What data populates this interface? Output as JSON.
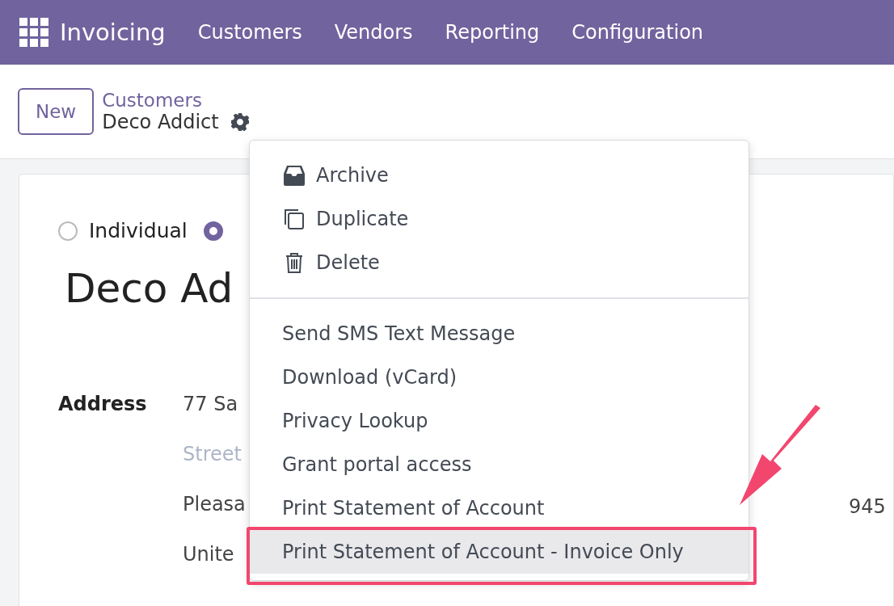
{
  "navbar": {
    "app_name": "Invoicing",
    "menu": [
      "Customers",
      "Vendors",
      "Reporting",
      "Configuration"
    ]
  },
  "control_panel": {
    "new_button": "New",
    "breadcrumb": "Customers",
    "record": "Deco Addict"
  },
  "form": {
    "company_types": [
      {
        "label": "Individual",
        "selected": false
      },
      {
        "selected": true
      }
    ],
    "name": "Deco Ad",
    "address_label": "Address",
    "street": "77 Sa",
    "street2_placeholder": "Street",
    "city": "Pleasa",
    "country": "Unite",
    "zip": "945"
  },
  "action_menu": {
    "groups": [
      [
        {
          "label": "Archive",
          "kind": "archive",
          "selected": false
        },
        {
          "label": "Duplicate",
          "kind": "duplicate",
          "selected": false
        },
        {
          "label": "Delete",
          "kind": "delete",
          "selected": false
        }
      ],
      [
        {
          "label": "Send SMS Text Message",
          "kind": "text",
          "selected": false
        },
        {
          "label": "Download (vCard)",
          "kind": "text",
          "selected": false
        },
        {
          "label": "Privacy Lookup",
          "kind": "text",
          "selected": false
        },
        {
          "label": "Grant portal access",
          "kind": "text",
          "selected": false
        },
        {
          "label": "Print Statement of Account",
          "kind": "text",
          "selected": false
        },
        {
          "label": "Print Statement of Account - Invoice Only",
          "kind": "text",
          "selected": true
        }
      ]
    ]
  }
}
